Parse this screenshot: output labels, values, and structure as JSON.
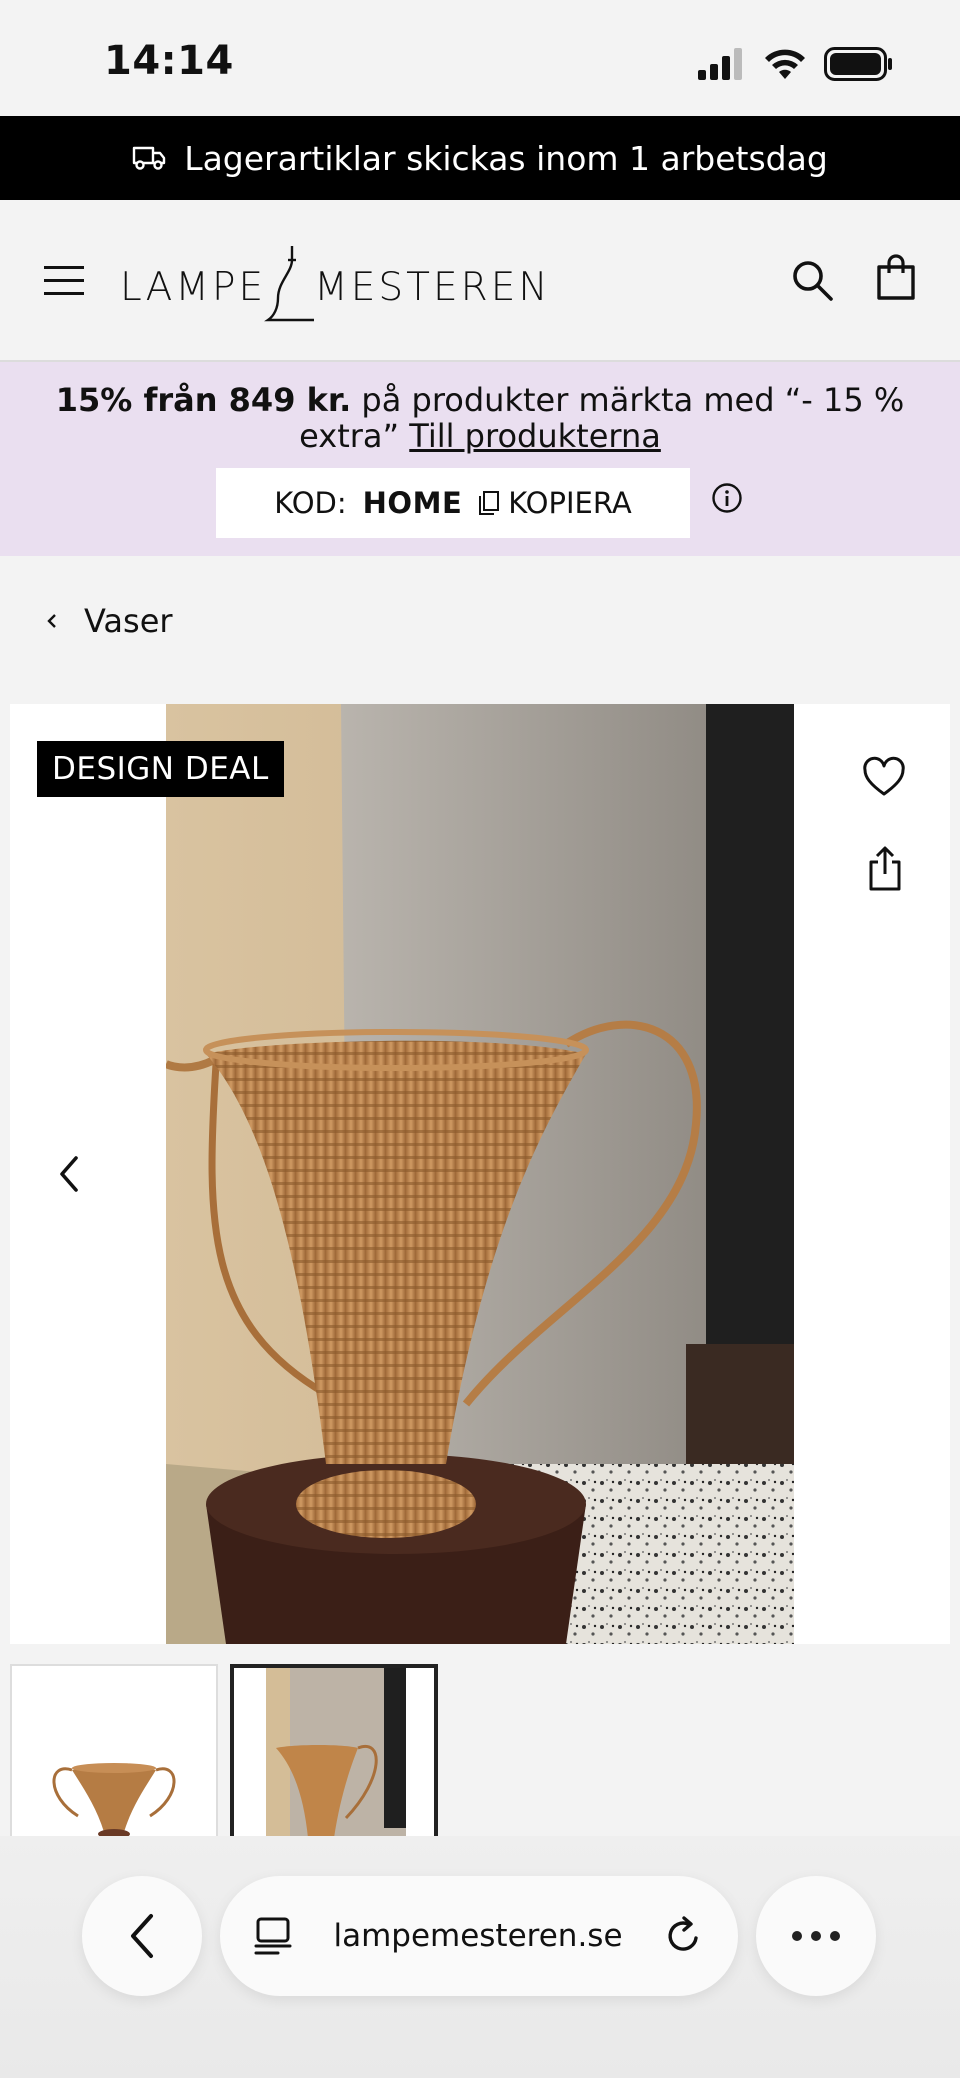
{
  "status_bar": {
    "time": "14:14",
    "signal_icon": "signal-icon",
    "wifi_icon": "wifi-icon",
    "battery_icon": "battery-icon"
  },
  "shipping_banner": {
    "icon": "truck-icon",
    "text": "Lagerartiklar skickas inom 1 arbetsdag"
  },
  "header": {
    "logo_left": "LAMPE",
    "logo_right": "MESTEREN",
    "menu_icon": "hamburger-menu-icon",
    "search_icon": "search-icon",
    "cart_icon": "shopping-bag-icon"
  },
  "promo": {
    "bold": "15% från 849 kr.",
    "text": " på produkter märkta med “- 15 % extra” ",
    "link": "Till produkterna",
    "code_label": "KOD:",
    "code_value": "HOME",
    "copy_label": "KOPIERA",
    "colors": {
      "background": "#eadff0"
    }
  },
  "breadcrumb": {
    "label": "Vaser"
  },
  "gallery": {
    "badge": "DESIGN DEAL",
    "favorite_icon": "heart-icon",
    "share_icon": "share-icon",
    "prev_icon": "chevron-left-icon",
    "thumbnails_count_visible": 2,
    "active_thumbnail": 2
  },
  "browser": {
    "url": "lampemesteren.se",
    "back_icon": "back-arrow-icon",
    "tabs_icon": "page-menu-icon",
    "reload_icon": "reload-icon",
    "more_icon": "more-dots-icon"
  }
}
